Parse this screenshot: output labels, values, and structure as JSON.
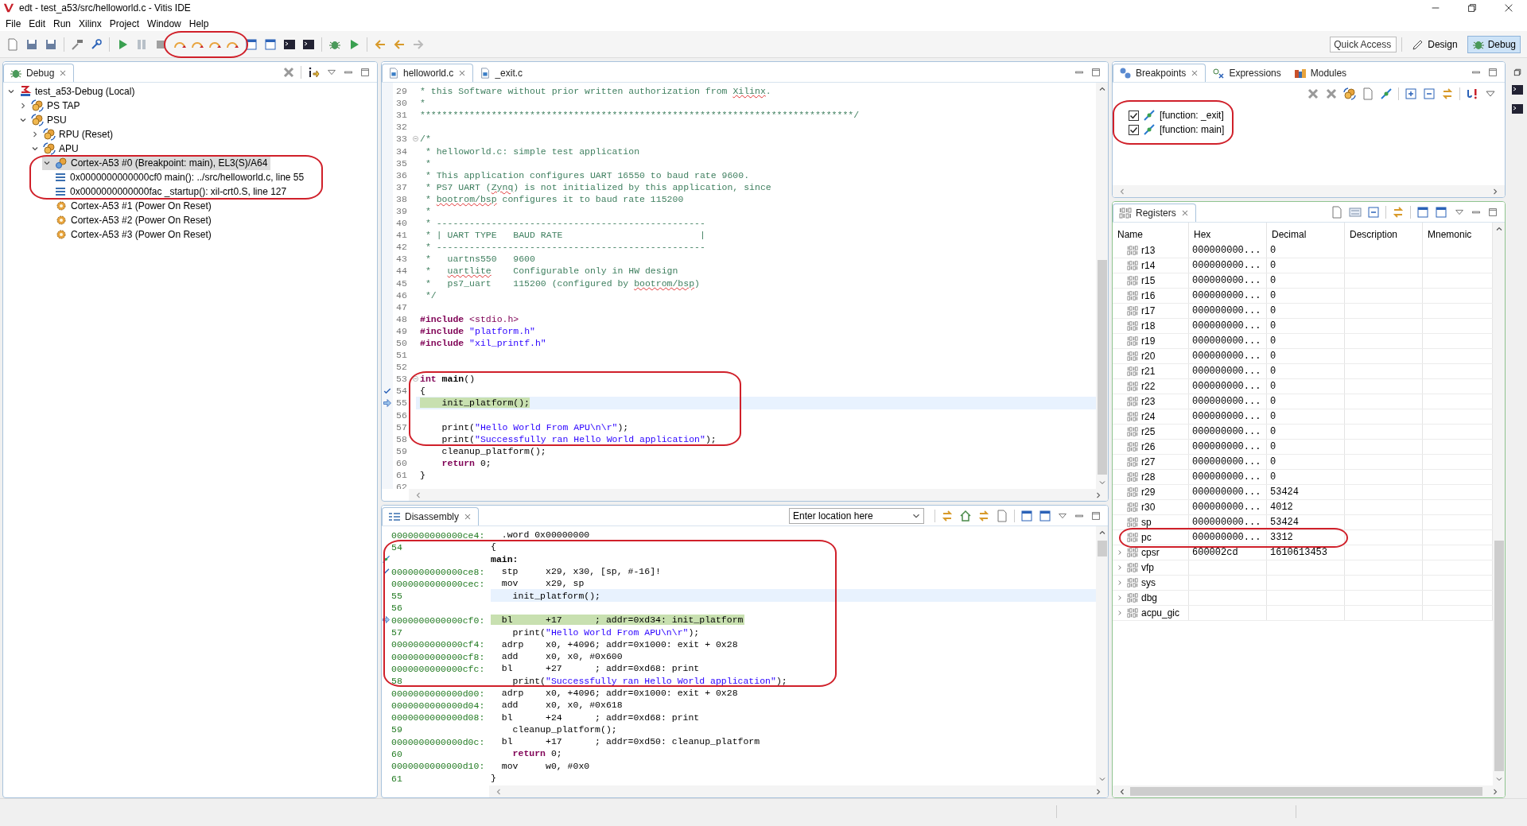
{
  "window": {
    "title": "edt - test_a53/src/helloworld.c - Vitis IDE"
  },
  "menu": [
    "File",
    "Edit",
    "Run",
    "Xilinx",
    "Project",
    "Window",
    "Help"
  ],
  "toolbar": {
    "step_group_circled": true,
    "quick_access": {
      "placeholder": "Quick Access"
    },
    "perspectives": [
      {
        "label": "Design",
        "selected": false
      },
      {
        "label": "Debug",
        "selected": true
      }
    ]
  },
  "debug_view": {
    "tab": "Debug",
    "tree": [
      {
        "label": "test_a53-Debug (Local)",
        "kind": "launch",
        "expanded": true,
        "selected": false,
        "children": [
          {
            "label": "PS TAP",
            "kind": "target",
            "expanded": false,
            "selected": false
          },
          {
            "label": "PSU",
            "kind": "target",
            "expanded": true,
            "selected": false,
            "children": [
              {
                "label": "RPU (Reset)",
                "kind": "target",
                "expanded": false,
                "selected": false
              },
              {
                "label": "APU",
                "kind": "target",
                "expanded": true,
                "selected": false,
                "children": [
                  {
                    "label": "Cortex-A53 #0 (Breakpoint: main), EL3(S)/A64",
                    "kind": "core_suspended",
                    "expanded": true,
                    "selected": true,
                    "circled": true,
                    "children": [
                      {
                        "label": "0x0000000000000cf0 main(): ../src/helloworld.c, line 55",
                        "kind": "frame",
                        "selected": false
                      },
                      {
                        "label": "0x0000000000000fac _startup(): xil-crt0.S, line 127",
                        "kind": "frame",
                        "selected": false
                      }
                    ]
                  },
                  {
                    "label": "Cortex-A53 #1 (Power On Reset)",
                    "kind": "core",
                    "selected": false
                  },
                  {
                    "label": "Cortex-A53 #2 (Power On Reset)",
                    "kind": "core",
                    "selected": false
                  },
                  {
                    "label": "Cortex-A53 #3 (Power On Reset)",
                    "kind": "core",
                    "selected": false
                  }
                ]
              }
            ]
          }
        ]
      }
    ]
  },
  "editor": {
    "tabs": [
      {
        "label": "helloworld.c",
        "selected": true
      },
      {
        "label": "_exit.c",
        "selected": false
      }
    ],
    "blocks": [
      {
        "circled": false,
        "lines": [
          {
            "number": "29",
            "segments": [
              {
                "kind": "comment",
                "text": "* this Software without prior written authorization from "
              },
              {
                "kind": "misspelled",
                "text": "Xilinx"
              },
              {
                "kind": "comment",
                "text": "."
              }
            ]
          },
          {
            "number": "30",
            "segments": [
              {
                "kind": "comment",
                "text": "*"
              }
            ]
          },
          {
            "number": "31",
            "segments": [
              {
                "kind": "comment",
                "text": "*******************************************************************************/"
              }
            ]
          },
          {
            "number": "32"
          },
          {
            "number": "33",
            "fold": true,
            "segments": [
              {
                "kind": "comment",
                "text": "/*"
              }
            ]
          },
          {
            "number": "34",
            "segments": [
              {
                "kind": "comment",
                "text": " * helloworld.c: simple test application"
              }
            ]
          },
          {
            "number": "35",
            "segments": [
              {
                "kind": "comment",
                "text": " *"
              }
            ]
          },
          {
            "number": "36",
            "segments": [
              {
                "kind": "comment",
                "text": " * This application configures UART 16550 to baud rate 9600."
              }
            ]
          },
          {
            "number": "37",
            "segments": [
              {
                "kind": "comment",
                "text": " * PS7 UART ("
              },
              {
                "kind": "misspelled",
                "text": "Zynq"
              },
              {
                "kind": "comment",
                "text": ") is not initialized by this application, since"
              }
            ]
          },
          {
            "number": "38",
            "segments": [
              {
                "kind": "comment",
                "text": " * "
              },
              {
                "kind": "misspelled",
                "text": "bootrom/bsp"
              },
              {
                "kind": "comment",
                "text": " configures it to baud rate 115200"
              }
            ]
          },
          {
            "number": "39",
            "segments": [
              {
                "kind": "comment",
                "text": " *"
              }
            ]
          },
          {
            "number": "40",
            "segments": [
              {
                "kind": "comment",
                "text": " * -------------------------------------------------"
              }
            ]
          },
          {
            "number": "41",
            "segments": [
              {
                "kind": "comment",
                "text": " * | UART TYPE   BAUD RATE                         |"
              }
            ]
          },
          {
            "number": "42",
            "segments": [
              {
                "kind": "comment",
                "text": " * -------------------------------------------------"
              }
            ]
          },
          {
            "number": "43",
            "segments": [
              {
                "kind": "comment",
                "text": " *   uartns550   9600"
              }
            ]
          },
          {
            "number": "44",
            "segments": [
              {
                "kind": "comment",
                "text": " *   "
              },
              {
                "kind": "misspelled",
                "text": "uartlite"
              },
              {
                "kind": "comment",
                "text": "    Configurable only in HW design"
              }
            ]
          },
          {
            "number": "45",
            "segments": [
              {
                "kind": "comment",
                "text": " *   ps7_uart    115200 (configured by "
              },
              {
                "kind": "misspelled",
                "text": "bootrom/bsp"
              },
              {
                "kind": "comment",
                "text": ")"
              }
            ]
          },
          {
            "number": "46",
            "segments": [
              {
                "kind": "comment",
                "text": " */"
              }
            ]
          },
          {
            "number": "47"
          },
          {
            "number": "48",
            "segments": [
              {
                "kind": "keyword",
                "text": "#include"
              },
              {
                "kind": "header",
                "text": " <stdio.h>"
              }
            ]
          },
          {
            "number": "49",
            "segments": [
              {
                "kind": "keyword",
                "text": "#include"
              },
              {
                "kind": "string",
                "text": " \"platform.h\""
              }
            ]
          },
          {
            "number": "50",
            "segments": [
              {
                "kind": "keyword",
                "text": "#include"
              },
              {
                "kind": "string",
                "text": " \"xil_printf.h\""
              }
            ]
          },
          {
            "number": "51"
          },
          {
            "number": "52"
          }
        ]
      },
      {
        "circled": true,
        "lines": [
          {
            "number": "53",
            "fold": true,
            "segments": [
              {
                "kind": "keyword",
                "text": "int"
              },
              {
                "kind": "function",
                "text": " main"
              },
              {
                "kind": "plain",
                "text": "()"
              }
            ]
          },
          {
            "number": "54",
            "breakpoint": true,
            "segments": [
              {
                "kind": "plain",
                "text": "{"
              }
            ]
          },
          {
            "number": "55",
            "current": true,
            "segments": [
              {
                "kind": "plain",
                "text": "    init_platform();"
              }
            ]
          },
          {
            "number": "56"
          },
          {
            "number": "57",
            "segments": [
              {
                "kind": "plain",
                "text": "    print("
              },
              {
                "kind": "string",
                "text": "\"Hello World From APU\\n\\r\""
              },
              {
                "kind": "plain",
                "text": ");"
              }
            ]
          },
          {
            "number": "58",
            "segments": [
              {
                "kind": "plain",
                "text": "    print("
              },
              {
                "kind": "string",
                "text": "\"Successfully ran Hello World application\""
              },
              {
                "kind": "plain",
                "text": ");"
              }
            ]
          }
        ]
      },
      {
        "circled": false,
        "lines": [
          {
            "number": "59",
            "segments": [
              {
                "kind": "plain",
                "text": "    cleanup_platform();"
              }
            ]
          },
          {
            "number": "60",
            "segments": [
              {
                "kind": "keyword",
                "text": "    return"
              },
              {
                "kind": "plain",
                "text": " 0;"
              }
            ]
          },
          {
            "number": "61",
            "segments": [
              {
                "kind": "plain",
                "text": "}"
              }
            ]
          },
          {
            "number": "62"
          }
        ]
      }
    ]
  },
  "disassembly": {
    "tab": "Disassembly",
    "location": {
      "placeholder": "Enter location here"
    },
    "blocks": [
      {
        "circled": false,
        "rows": [
          {
            "kind": "instruction",
            "address": "0000000000000ce4:",
            "text": "  .word 0x00000000"
          }
        ]
      },
      {
        "circled": true,
        "rows": [
          {
            "kind": "source",
            "line": "54",
            "segments": [
              {
                "kind": "plain",
                "text": "{"
              }
            ]
          },
          {
            "kind": "label",
            "breakpoint": true,
            "text": "main:"
          },
          {
            "kind": "instruction",
            "breakpoint": true,
            "address": "0000000000000ce8:",
            "text": "  stp     x29, x30, [sp, #-16]!"
          },
          {
            "kind": "instruction",
            "address": "0000000000000cec:",
            "text": "  mov     x29, sp"
          },
          {
            "kind": "source",
            "line": "55",
            "current": true,
            "segments": [
              {
                "kind": "plain",
                "text": "    init_platform();"
              }
            ]
          },
          {
            "kind": "source",
            "line": "56"
          },
          {
            "kind": "instruction",
            "current": true,
            "address": "0000000000000cf0:",
            "text": "  bl      +17      ; addr=0xd34: init_platform"
          },
          {
            "kind": "source",
            "line": "57",
            "segments": [
              {
                "kind": "plain",
                "text": "    print("
              },
              {
                "kind": "string",
                "text": "\"Hello World From APU\\n\\r\""
              },
              {
                "kind": "plain",
                "text": ");"
              }
            ]
          },
          {
            "kind": "instruction",
            "address": "0000000000000cf4:",
            "text": "  adrp    x0, +4096; addr=0x1000: exit + 0x28"
          },
          {
            "kind": "instruction",
            "address": "0000000000000cf8:",
            "text": "  add     x0, x0, #0x600"
          },
          {
            "kind": "instruction",
            "address": "0000000000000cfc:",
            "text": "  bl      +27      ; addr=0xd68: print"
          },
          {
            "kind": "source",
            "line": "58",
            "segments": [
              {
                "kind": "plain",
                "text": "    print("
              },
              {
                "kind": "string",
                "text": "\"Successfully ran Hello World application\""
              },
              {
                "kind": "plain",
                "text": ");"
              }
            ]
          }
        ]
      },
      {
        "circled": false,
        "rows": [
          {
            "kind": "instruction",
            "address": "0000000000000d00:",
            "text": "  adrp    x0, +4096; addr=0x1000: exit + 0x28"
          },
          {
            "kind": "instruction",
            "address": "0000000000000d04:",
            "text": "  add     x0, x0, #0x618"
          },
          {
            "kind": "instruction",
            "address": "0000000000000d08:",
            "text": "  bl      +24      ; addr=0xd68: print"
          },
          {
            "kind": "source",
            "line": "59",
            "segments": [
              {
                "kind": "plain",
                "text": "    cleanup_platform();"
              }
            ]
          },
          {
            "kind": "instruction",
            "address": "0000000000000d0c:",
            "text": "  bl      +17      ; addr=0xd50: cleanup_platform"
          },
          {
            "kind": "source",
            "line": "60",
            "segments": [
              {
                "kind": "keyword",
                "text": "    return"
              },
              {
                "kind": "plain",
                "text": " 0;"
              }
            ]
          },
          {
            "kind": "instruction",
            "address": "0000000000000d10:",
            "text": "  mov     w0, #0x0"
          },
          {
            "kind": "source",
            "line": "61",
            "segments": [
              {
                "kind": "plain",
                "text": "}"
              }
            ]
          }
        ]
      }
    ]
  },
  "breakpoints_view": {
    "tabs": [
      {
        "label": "Breakpoints",
        "selected": true
      },
      {
        "label": "Expressions",
        "selected": false
      },
      {
        "label": "Modules",
        "selected": false
      }
    ],
    "circled": true,
    "items": [
      {
        "label": "[function: _exit]",
        "checked": true
      },
      {
        "label": "[function: main]",
        "checked": true
      }
    ]
  },
  "registers_view": {
    "tab": "Registers",
    "columns": [
      "Name",
      "Hex",
      "Decimal",
      "Description",
      "Mnemonic"
    ],
    "rows": [
      {
        "name": "r13",
        "hex": "000000000...",
        "decimal": "0"
      },
      {
        "name": "r14",
        "hex": "000000000...",
        "decimal": "0"
      },
      {
        "name": "r15",
        "hex": "000000000...",
        "decimal": "0"
      },
      {
        "name": "r16",
        "hex": "000000000...",
        "decimal": "0"
      },
      {
        "name": "r17",
        "hex": "000000000...",
        "decimal": "0"
      },
      {
        "name": "r18",
        "hex": "000000000...",
        "decimal": "0"
      },
      {
        "name": "r19",
        "hex": "000000000...",
        "decimal": "0"
      },
      {
        "name": "r20",
        "hex": "000000000...",
        "decimal": "0"
      },
      {
        "name": "r21",
        "hex": "000000000...",
        "decimal": "0"
      },
      {
        "name": "r22",
        "hex": "000000000...",
        "decimal": "0"
      },
      {
        "name": "r23",
        "hex": "000000000...",
        "decimal": "0"
      },
      {
        "name": "r24",
        "hex": "000000000...",
        "decimal": "0"
      },
      {
        "name": "r25",
        "hex": "000000000...",
        "decimal": "0"
      },
      {
        "name": "r26",
        "hex": "000000000...",
        "decimal": "0"
      },
      {
        "name": "r27",
        "hex": "000000000...",
        "decimal": "0"
      },
      {
        "name": "r28",
        "hex": "000000000...",
        "decimal": "0"
      },
      {
        "name": "r29",
        "hex": "000000000...",
        "decimal": "53424"
      },
      {
        "name": "r30",
        "hex": "000000000...",
        "decimal": "4012"
      },
      {
        "name": "sp",
        "hex": "000000000...",
        "decimal": "53424"
      },
      {
        "name": "pc",
        "hex": "000000000...",
        "decimal": "3312",
        "circled": true
      },
      {
        "name": "cpsr",
        "hex": "600002cd",
        "decimal": "1610613453",
        "expanded": false
      },
      {
        "name": "vfp",
        "expanded": false
      },
      {
        "name": "sys",
        "expanded": false
      },
      {
        "name": "dbg",
        "expanded": false
      },
      {
        "name": "acpu_gic",
        "expanded": false
      }
    ]
  }
}
